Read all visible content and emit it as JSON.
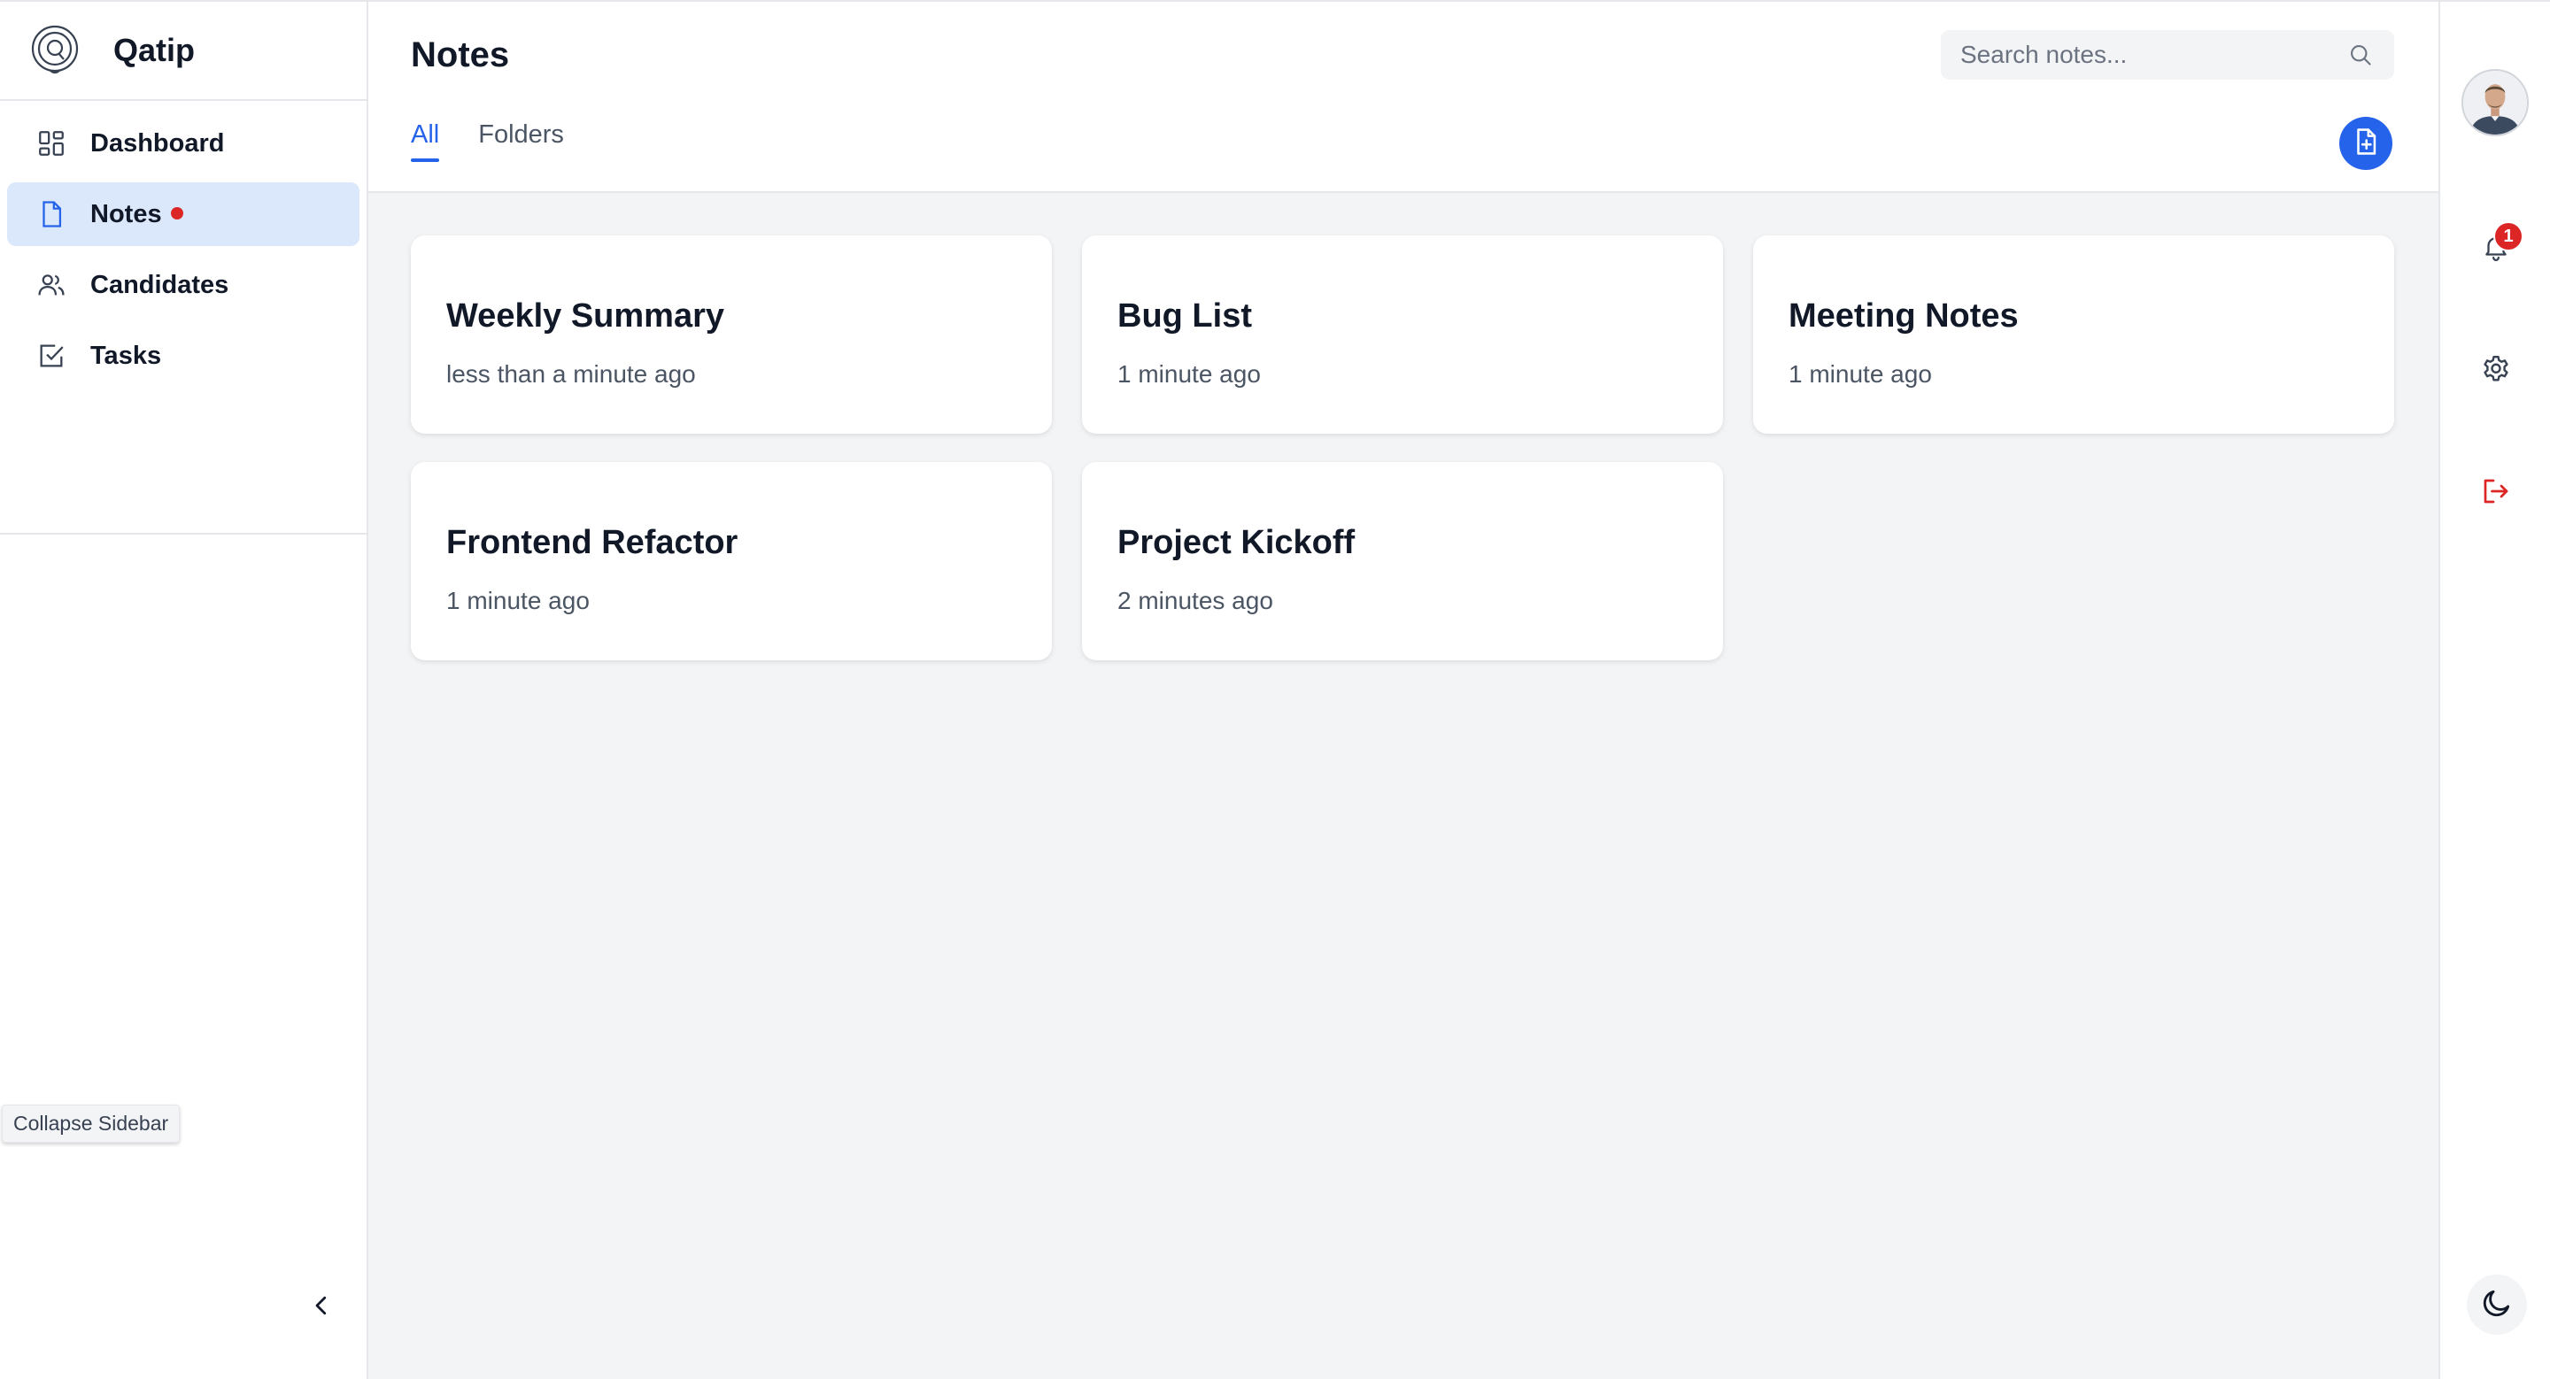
{
  "app": {
    "name": "Qatip"
  },
  "sidebar": {
    "items": [
      {
        "label": "Dashboard",
        "icon": "dashboard-icon",
        "active": false
      },
      {
        "label": "Notes",
        "icon": "note-icon",
        "active": true,
        "indicator": "unread-dot"
      },
      {
        "label": "Candidates",
        "icon": "users-icon",
        "active": false
      },
      {
        "label": "Tasks",
        "icon": "task-check-icon",
        "active": false
      }
    ],
    "collapse_tooltip": "Collapse Sidebar",
    "collapse_icon": "chevron-left-icon"
  },
  "header": {
    "title": "Notes",
    "search": {
      "placeholder": "Search notes...",
      "value": ""
    },
    "tabs": [
      {
        "label": "All",
        "active": true
      },
      {
        "label": "Folders",
        "active": false
      }
    ],
    "new_note_icon": "file-plus-icon"
  },
  "notes": [
    {
      "title": "Weekly Summary",
      "time": "less than a minute ago"
    },
    {
      "title": "Bug List",
      "time": "1 minute ago"
    },
    {
      "title": "Meeting Notes",
      "time": "1 minute ago"
    },
    {
      "title": "Frontend Refactor",
      "time": "1 minute ago"
    },
    {
      "title": "Project Kickoff",
      "time": "2 minutes ago"
    }
  ],
  "rail": {
    "notifications_count": "1",
    "icons": [
      "avatar",
      "bell-icon",
      "gear-icon",
      "logout-icon",
      "moon-icon"
    ]
  },
  "colors": {
    "accent": "#2563eb",
    "active_nav_bg": "#dbe7fa",
    "alert": "#dc2626",
    "logout": "#dc2626",
    "content_bg": "#f3f4f6"
  }
}
